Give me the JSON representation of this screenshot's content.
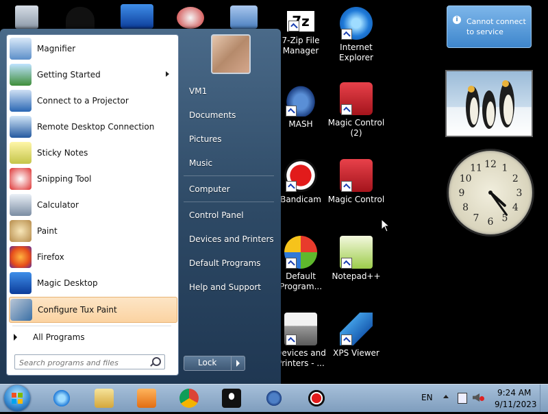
{
  "desktop": {
    "icons": [
      {
        "label": "7-Zip File Manager",
        "line1": "7-Zip File",
        "line2": "Manager"
      },
      {
        "label": "Internet Explorer",
        "line1": "Internet",
        "line2": "Explorer"
      },
      {
        "label": "MASH",
        "line1": "MASH",
        "line2": ""
      },
      {
        "label": "Magic Control (2)",
        "line1": "Magic Control",
        "line2": "(2)"
      },
      {
        "label": "Bandicam",
        "line1": "Bandicam",
        "line2": ""
      },
      {
        "label": "Magic Control",
        "line1": "Magic Control",
        "line2": ""
      },
      {
        "label": "Default Program...",
        "line1": "Default",
        "line2": "Program..."
      },
      {
        "label": "Notepad++",
        "line1": "Notepad++",
        "line2": ""
      },
      {
        "label": "Devices and Printers - ...",
        "line1": "Devices and",
        "line2": "Printers - ..."
      },
      {
        "label": "XPS Viewer",
        "line1": "XPS Viewer",
        "line2": ""
      }
    ]
  },
  "start_menu": {
    "programs": [
      {
        "label": "Magnifier",
        "icon": "magnifier-icon"
      },
      {
        "label": "Getting Started",
        "icon": "getting-started-icon",
        "submenu": true
      },
      {
        "label": "Connect to a Projector",
        "icon": "projector-icon"
      },
      {
        "label": "Remote Desktop Connection",
        "icon": "remote-desktop-icon"
      },
      {
        "label": "Sticky Notes",
        "icon": "sticky-notes-icon"
      },
      {
        "label": "Snipping Tool",
        "icon": "scissors-icon"
      },
      {
        "label": "Calculator",
        "icon": "calculator-icon"
      },
      {
        "label": "Paint",
        "icon": "paint-palette-icon"
      },
      {
        "label": "Firefox",
        "icon": "firefox-icon"
      },
      {
        "label": "Magic Desktop",
        "icon": "magic-desktop-icon"
      },
      {
        "label": "Configure Tux Paint",
        "icon": "wrench-icon",
        "highlighted": true
      }
    ],
    "all_programs": "All Programs",
    "search_placeholder": "Search programs and files",
    "right_items": [
      "VM1",
      "Documents",
      "Pictures",
      "Music",
      "Computer",
      "Control Panel",
      "Devices and Printers",
      "Default Programs",
      "Help and Support"
    ],
    "lock_label": "Lock"
  },
  "gadgets": {
    "notification": {
      "line1": "Cannot connect",
      "line2": "to service"
    },
    "clock": {
      "hour": 4,
      "minute": 24,
      "numerals": [
        "12",
        "1",
        "2",
        "3",
        "4",
        "5",
        "6",
        "7",
        "8",
        "9",
        "10",
        "11"
      ]
    }
  },
  "taskbar": {
    "apps": [
      "internet-explorer-icon",
      "file-explorer-icon",
      "media-player-icon",
      "chrome-icon",
      "tux-icon",
      "mash-icon",
      "bandicam-icon"
    ],
    "language": "EN",
    "time": "9:24 AM",
    "date": "9/11/2023"
  },
  "colors": {
    "highlight": "#fbd3a2",
    "taskbar": "#8fabc9",
    "menu_dark": "#2e4a66"
  }
}
